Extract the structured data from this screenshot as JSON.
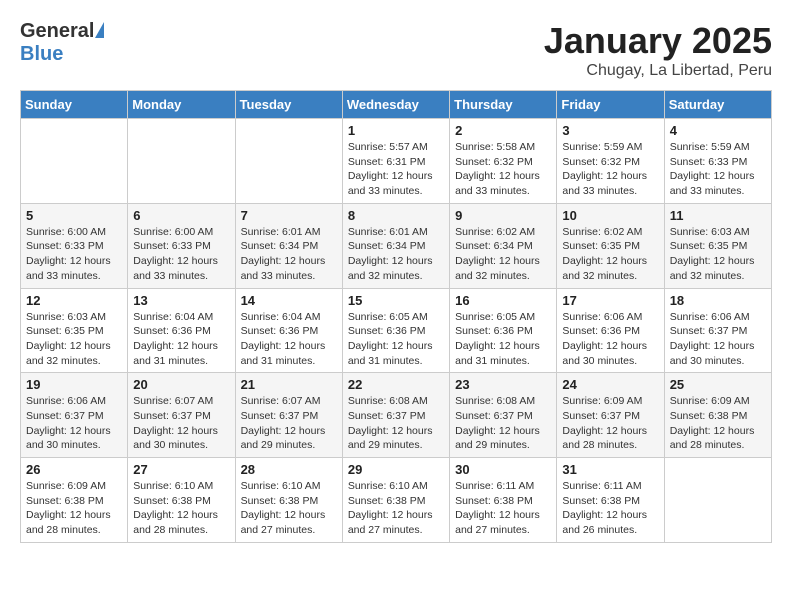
{
  "header": {
    "logo_general": "General",
    "logo_blue": "Blue",
    "month_title": "January 2025",
    "subtitle": "Chugay, La Libertad, Peru"
  },
  "days_of_week": [
    "Sunday",
    "Monday",
    "Tuesday",
    "Wednesday",
    "Thursday",
    "Friday",
    "Saturday"
  ],
  "weeks": [
    [
      {
        "day": "",
        "info": ""
      },
      {
        "day": "",
        "info": ""
      },
      {
        "day": "",
        "info": ""
      },
      {
        "day": "1",
        "info": "Sunrise: 5:57 AM\nSunset: 6:31 PM\nDaylight: 12 hours\nand 33 minutes."
      },
      {
        "day": "2",
        "info": "Sunrise: 5:58 AM\nSunset: 6:32 PM\nDaylight: 12 hours\nand 33 minutes."
      },
      {
        "day": "3",
        "info": "Sunrise: 5:59 AM\nSunset: 6:32 PM\nDaylight: 12 hours\nand 33 minutes."
      },
      {
        "day": "4",
        "info": "Sunrise: 5:59 AM\nSunset: 6:33 PM\nDaylight: 12 hours\nand 33 minutes."
      }
    ],
    [
      {
        "day": "5",
        "info": "Sunrise: 6:00 AM\nSunset: 6:33 PM\nDaylight: 12 hours\nand 33 minutes."
      },
      {
        "day": "6",
        "info": "Sunrise: 6:00 AM\nSunset: 6:33 PM\nDaylight: 12 hours\nand 33 minutes."
      },
      {
        "day": "7",
        "info": "Sunrise: 6:01 AM\nSunset: 6:34 PM\nDaylight: 12 hours\nand 33 minutes."
      },
      {
        "day": "8",
        "info": "Sunrise: 6:01 AM\nSunset: 6:34 PM\nDaylight: 12 hours\nand 32 minutes."
      },
      {
        "day": "9",
        "info": "Sunrise: 6:02 AM\nSunset: 6:34 PM\nDaylight: 12 hours\nand 32 minutes."
      },
      {
        "day": "10",
        "info": "Sunrise: 6:02 AM\nSunset: 6:35 PM\nDaylight: 12 hours\nand 32 minutes."
      },
      {
        "day": "11",
        "info": "Sunrise: 6:03 AM\nSunset: 6:35 PM\nDaylight: 12 hours\nand 32 minutes."
      }
    ],
    [
      {
        "day": "12",
        "info": "Sunrise: 6:03 AM\nSunset: 6:35 PM\nDaylight: 12 hours\nand 32 minutes."
      },
      {
        "day": "13",
        "info": "Sunrise: 6:04 AM\nSunset: 6:36 PM\nDaylight: 12 hours\nand 31 minutes."
      },
      {
        "day": "14",
        "info": "Sunrise: 6:04 AM\nSunset: 6:36 PM\nDaylight: 12 hours\nand 31 minutes."
      },
      {
        "day": "15",
        "info": "Sunrise: 6:05 AM\nSunset: 6:36 PM\nDaylight: 12 hours\nand 31 minutes."
      },
      {
        "day": "16",
        "info": "Sunrise: 6:05 AM\nSunset: 6:36 PM\nDaylight: 12 hours\nand 31 minutes."
      },
      {
        "day": "17",
        "info": "Sunrise: 6:06 AM\nSunset: 6:36 PM\nDaylight: 12 hours\nand 30 minutes."
      },
      {
        "day": "18",
        "info": "Sunrise: 6:06 AM\nSunset: 6:37 PM\nDaylight: 12 hours\nand 30 minutes."
      }
    ],
    [
      {
        "day": "19",
        "info": "Sunrise: 6:06 AM\nSunset: 6:37 PM\nDaylight: 12 hours\nand 30 minutes."
      },
      {
        "day": "20",
        "info": "Sunrise: 6:07 AM\nSunset: 6:37 PM\nDaylight: 12 hours\nand 30 minutes."
      },
      {
        "day": "21",
        "info": "Sunrise: 6:07 AM\nSunset: 6:37 PM\nDaylight: 12 hours\nand 29 minutes."
      },
      {
        "day": "22",
        "info": "Sunrise: 6:08 AM\nSunset: 6:37 PM\nDaylight: 12 hours\nand 29 minutes."
      },
      {
        "day": "23",
        "info": "Sunrise: 6:08 AM\nSunset: 6:37 PM\nDaylight: 12 hours\nand 29 minutes."
      },
      {
        "day": "24",
        "info": "Sunrise: 6:09 AM\nSunset: 6:37 PM\nDaylight: 12 hours\nand 28 minutes."
      },
      {
        "day": "25",
        "info": "Sunrise: 6:09 AM\nSunset: 6:38 PM\nDaylight: 12 hours\nand 28 minutes."
      }
    ],
    [
      {
        "day": "26",
        "info": "Sunrise: 6:09 AM\nSunset: 6:38 PM\nDaylight: 12 hours\nand 28 minutes."
      },
      {
        "day": "27",
        "info": "Sunrise: 6:10 AM\nSunset: 6:38 PM\nDaylight: 12 hours\nand 28 minutes."
      },
      {
        "day": "28",
        "info": "Sunrise: 6:10 AM\nSunset: 6:38 PM\nDaylight: 12 hours\nand 27 minutes."
      },
      {
        "day": "29",
        "info": "Sunrise: 6:10 AM\nSunset: 6:38 PM\nDaylight: 12 hours\nand 27 minutes."
      },
      {
        "day": "30",
        "info": "Sunrise: 6:11 AM\nSunset: 6:38 PM\nDaylight: 12 hours\nand 27 minutes."
      },
      {
        "day": "31",
        "info": "Sunrise: 6:11 AM\nSunset: 6:38 PM\nDaylight: 12 hours\nand 26 minutes."
      },
      {
        "day": "",
        "info": ""
      }
    ]
  ]
}
